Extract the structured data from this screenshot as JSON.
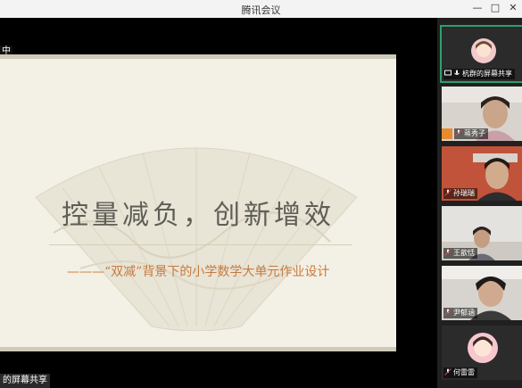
{
  "window": {
    "title": "腾讯会议"
  },
  "main": {
    "status_top": "中",
    "status_bottom": "的屏幕共享"
  },
  "slide": {
    "title": "控量减负，创新增效",
    "subtitle": "———“双减”背景下的小学数学大单元作业设计"
  },
  "participants": [
    {
      "name": "杭群的屏幕共享",
      "kind": "avatar"
    },
    {
      "name": "蒋秀子",
      "kind": "camera"
    },
    {
      "name": "孙瑞瑞",
      "kind": "camera"
    },
    {
      "name": "王歆恬",
      "kind": "camera"
    },
    {
      "name": "尹郁涵",
      "kind": "camera"
    },
    {
      "name": "何雷雷",
      "kind": "avatar"
    }
  ],
  "colors": {
    "accent_green": "#2f9e6b",
    "subtitle_orange": "#c77a3c"
  }
}
